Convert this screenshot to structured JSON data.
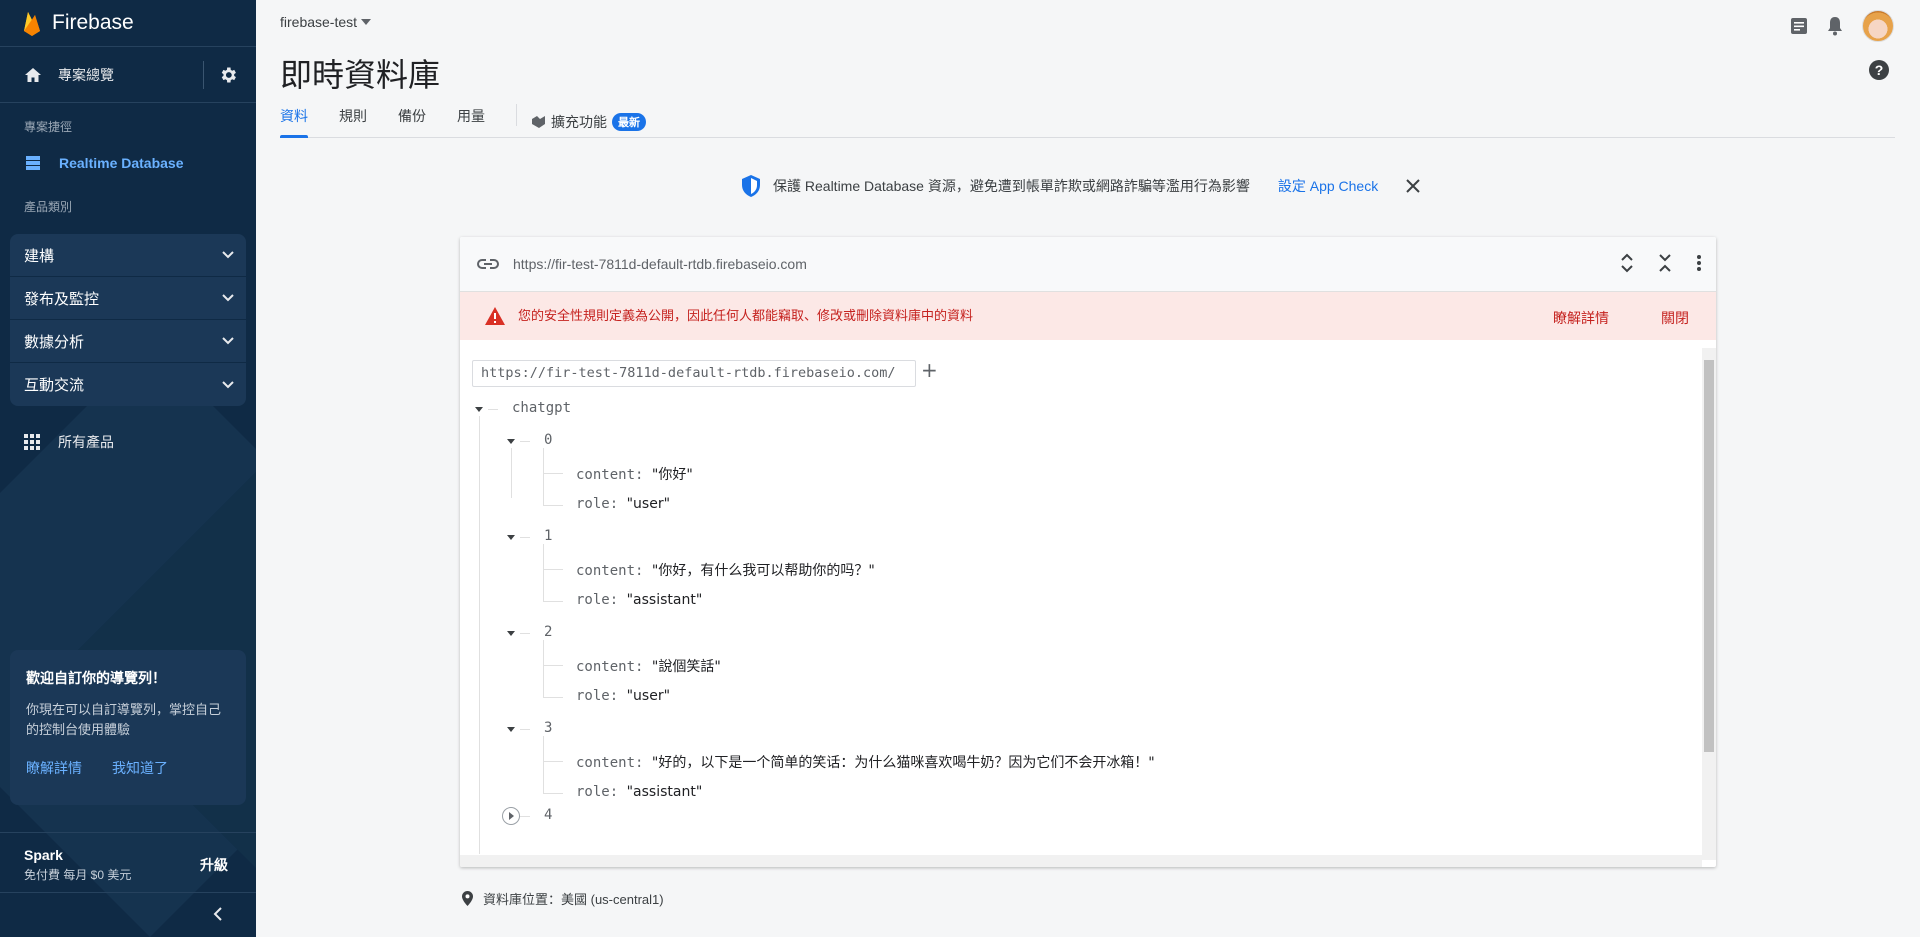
{
  "sidebar": {
    "brand": "Firebase",
    "overview_label": "專案總覽",
    "shortcuts_heading": "專案捷徑",
    "shortcut_item": "Realtime Database",
    "categories_heading": "產品類別",
    "groups": [
      "建構",
      "發布及監控",
      "數據分析",
      "互動交流"
    ],
    "all_products": "所有產品",
    "promo": {
      "title": "歡迎自訂你的導覽列！",
      "body": "你現在可以自訂導覽列，掌控自己的控制台使用體驗",
      "learn_more": "瞭解詳情",
      "got_it": "我知道了"
    },
    "plan": {
      "name": "Spark",
      "desc": "免付費 每月 $0 美元",
      "upgrade": "升級"
    }
  },
  "header": {
    "project": "firebase-test",
    "title": "即時資料庫"
  },
  "tabs": [
    {
      "label": "資料",
      "active": true
    },
    {
      "label": "規則"
    },
    {
      "label": "備份"
    },
    {
      "label": "用量"
    }
  ],
  "extensions_tab": {
    "label": "擴充功能",
    "badge": "最新"
  },
  "appcheck": {
    "message": "保護 Realtime Database 資源，避免遭到帳單詐欺或網路詐騙等濫用行為影響",
    "link": "設定 App Check"
  },
  "database": {
    "url": "https://fir-test-7811d-default-rtdb.firebaseio.com",
    "warning": "您的安全性規則定義為公開，因此任何人都能竊取、修改或刪除資料庫中的資料",
    "warning_learn": "瞭解詳情",
    "warning_close": "關閉",
    "path": "https://fir-test-7811d-default-rtdb.firebaseio.com/",
    "root_key": "chatgpt",
    "entries": [
      {
        "index": "0",
        "content": "\"你好\"",
        "role": "\"user\""
      },
      {
        "index": "1",
        "content": "\"你好，有什么我可以帮助你的吗？\"",
        "role": "\"assistant\""
      },
      {
        "index": "2",
        "content": "\"說個笑話\"",
        "role": "\"user\""
      },
      {
        "index": "3",
        "content": "\"好的，以下是一个简单的笑话：为什么猫咪喜欢喝牛奶？因为它们不会开冰箱！\"",
        "role": "\"assistant\""
      }
    ],
    "collapsed_entry": "4",
    "content_key": "content:",
    "role_key": "role:"
  },
  "footer": {
    "location": "資料庫位置：美國 (us-central1)"
  },
  "colors": {
    "sidebar": "#0f2a45",
    "accent": "#1a73e8",
    "warning_bg": "#fce8e6",
    "warning_text": "#c5221f"
  }
}
